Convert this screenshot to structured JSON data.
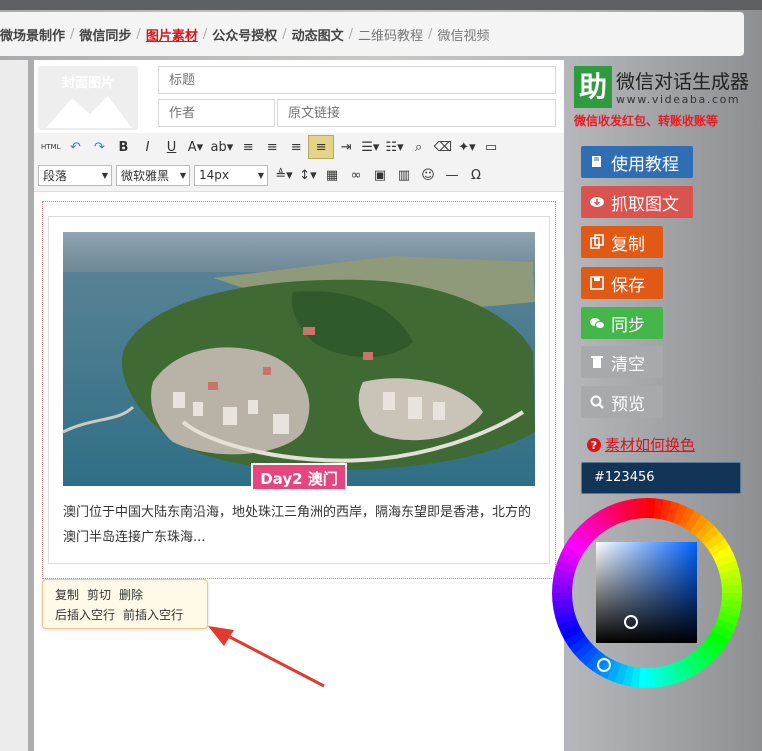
{
  "breadcrumb": {
    "items": [
      {
        "label": "微场景制作",
        "state": "normal"
      },
      {
        "label": "微信同步",
        "state": "normal"
      },
      {
        "label": "图片素材",
        "state": "active"
      },
      {
        "label": "公众号授权",
        "state": "normal"
      },
      {
        "label": "动态图文",
        "state": "normal"
      },
      {
        "label": "二维码教程",
        "state": "muted"
      },
      {
        "label": "微信视频",
        "state": "muted"
      }
    ],
    "separator": "/"
  },
  "cover": {
    "label": "封面图片"
  },
  "fields": {
    "title_placeholder": "标题",
    "author_placeholder": "作者",
    "source_placeholder": "原文链接"
  },
  "toolbar": {
    "row1": [
      {
        "name": "html-source-button",
        "glyph": "HTML",
        "active": false
      },
      {
        "name": "undo-icon",
        "glyph": "↶",
        "active": false
      },
      {
        "name": "redo-icon",
        "glyph": "↷",
        "active": false
      },
      {
        "name": "bold-button",
        "glyph": "B",
        "active": false
      },
      {
        "name": "italic-button",
        "glyph": "I",
        "active": false
      },
      {
        "name": "underline-button",
        "glyph": "U",
        "active": false
      },
      {
        "name": "font-color-button",
        "glyph": "A▾",
        "active": false
      },
      {
        "name": "highlight-color-button",
        "glyph": "ab▾",
        "active": false
      },
      {
        "name": "align-left-icon",
        "glyph": "≡",
        "active": false
      },
      {
        "name": "align-center-icon",
        "glyph": "≡",
        "active": false
      },
      {
        "name": "align-right-icon",
        "glyph": "≡",
        "active": false
      },
      {
        "name": "align-justify-icon",
        "glyph": "≡",
        "active": true
      },
      {
        "name": "indent-icon",
        "glyph": "⇥",
        "active": false
      },
      {
        "name": "unordered-list-icon",
        "glyph": "☰▾",
        "active": false
      },
      {
        "name": "ordered-list-icon",
        "glyph": "☷▾",
        "active": false
      },
      {
        "name": "find-icon",
        "glyph": "⌕",
        "active": false
      },
      {
        "name": "eraser-icon",
        "glyph": "⌫",
        "active": false
      },
      {
        "name": "magic-format-icon",
        "glyph": "✦▾",
        "active": false
      },
      {
        "name": "preview-monitor-icon",
        "glyph": "▭",
        "active": false
      }
    ],
    "paragraph_value": "段落",
    "font_value": "微软雅黑",
    "size_value": "14px",
    "row2": [
      {
        "name": "line-height-icon",
        "glyph": "≜▾"
      },
      {
        "name": "spacing-icon",
        "glyph": "↕▾"
      },
      {
        "name": "table-icon",
        "glyph": "▦"
      },
      {
        "name": "link-icon",
        "glyph": "∞"
      },
      {
        "name": "image-icon",
        "glyph": "▣"
      },
      {
        "name": "video-icon",
        "glyph": "▥"
      },
      {
        "name": "emoji-icon",
        "glyph": "☺"
      },
      {
        "name": "horizontal-rule-icon",
        "glyph": "—"
      },
      {
        "name": "special-char-icon",
        "glyph": "Ω"
      }
    ]
  },
  "article": {
    "tag": "Day2 澳门",
    "description": "澳门位于中国大陆东南沿海，地处珠江三角洲的西岸，隔海东望即是香港，北方的澳门半岛连接广东珠海..."
  },
  "context_menu": {
    "row1": [
      "复制",
      "剪切",
      "删除"
    ],
    "row2": [
      "后插入空行",
      "前插入空行"
    ]
  },
  "brand": {
    "logo_char": "助",
    "title": "微信对话生成器",
    "url": "www.videaba.com",
    "slogan": "微信收发红包、转账收账等"
  },
  "side_buttons": [
    {
      "name": "tutorial-button",
      "icon": "book-icon",
      "label": "使用教程",
      "color": "#2f6eb2"
    },
    {
      "name": "fetch-article-button",
      "icon": "cloud-download-icon",
      "label": "抓取图文",
      "color": "#d9534f"
    },
    {
      "name": "copy-button",
      "icon": "copy-icon",
      "label": "复制",
      "color": "#e05a16"
    },
    {
      "name": "save-button",
      "icon": "save-icon",
      "label": "保存",
      "color": "#e05a16"
    },
    {
      "name": "sync-button",
      "icon": "wechat-icon",
      "label": "同步",
      "color": "#45b649"
    },
    {
      "name": "clear-button",
      "icon": "trash-icon",
      "label": "清空",
      "color": "#a8a9ad"
    },
    {
      "name": "preview-button",
      "icon": "search-icon",
      "label": "预览",
      "color": "#a8a9ad"
    }
  ],
  "color_help": {
    "label": "素材如何换色"
  },
  "color_value": "#123456",
  "colors": {
    "active_crumb": "#d9141a",
    "tag": "#e8447d",
    "picker_field": "#123456"
  }
}
